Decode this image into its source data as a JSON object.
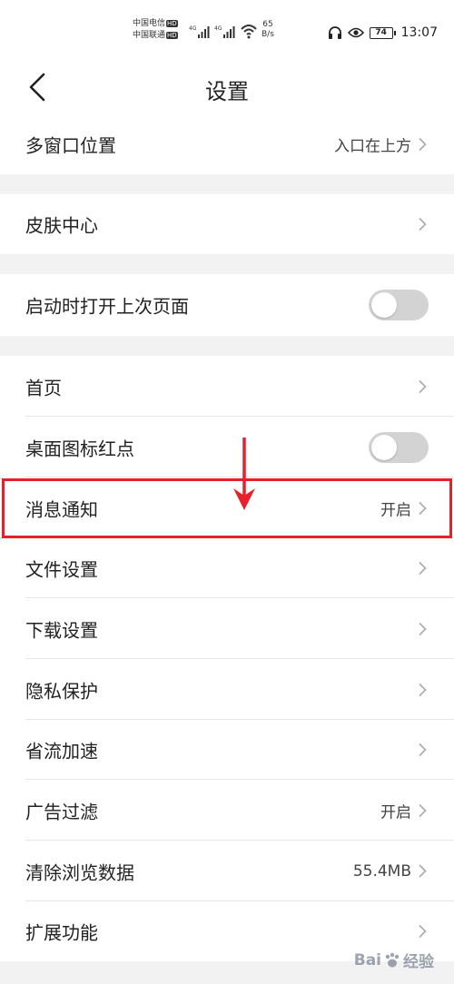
{
  "status_bar": {
    "carrier1": "中国电信",
    "carrier2": "中国联通",
    "hd_badge": "HD",
    "network1": "4G",
    "network2": "4G",
    "speed_value": "65",
    "speed_unit": "B/s",
    "battery": "74",
    "time": "13:07",
    "icons": [
      "headset-icon",
      "eye-icon",
      "wifi-icon",
      "signal-icon",
      "battery-icon"
    ]
  },
  "header": {
    "title": "设置",
    "back_icon": "chevron-left-icon"
  },
  "settings": {
    "multi_window": {
      "label": "多窗口位置",
      "value": "入口在上方"
    },
    "skin_center": {
      "label": "皮肤中心"
    },
    "open_last_page": {
      "label": "启动时打开上次页面",
      "enabled": false
    },
    "homepage": {
      "label": "首页"
    },
    "desktop_badge": {
      "label": "桌面图标红点",
      "enabled": false
    },
    "notifications": {
      "label": "消息通知",
      "value": "开启"
    },
    "file_settings": {
      "label": "文件设置"
    },
    "download_settings": {
      "label": "下载设置"
    },
    "privacy": {
      "label": "隐私保护"
    },
    "data_saver": {
      "label": "省流加速"
    },
    "ad_filter": {
      "label": "广告过滤",
      "value": "开启"
    },
    "clear_data": {
      "label": "清除浏览数据",
      "value": "55.4MB"
    },
    "extensions": {
      "label": "扩展功能"
    }
  },
  "annotation": {
    "highlight_color": "#e8202a",
    "target": "消息通知"
  },
  "watermark": {
    "text_left": "Bai",
    "text_right": "经验"
  }
}
